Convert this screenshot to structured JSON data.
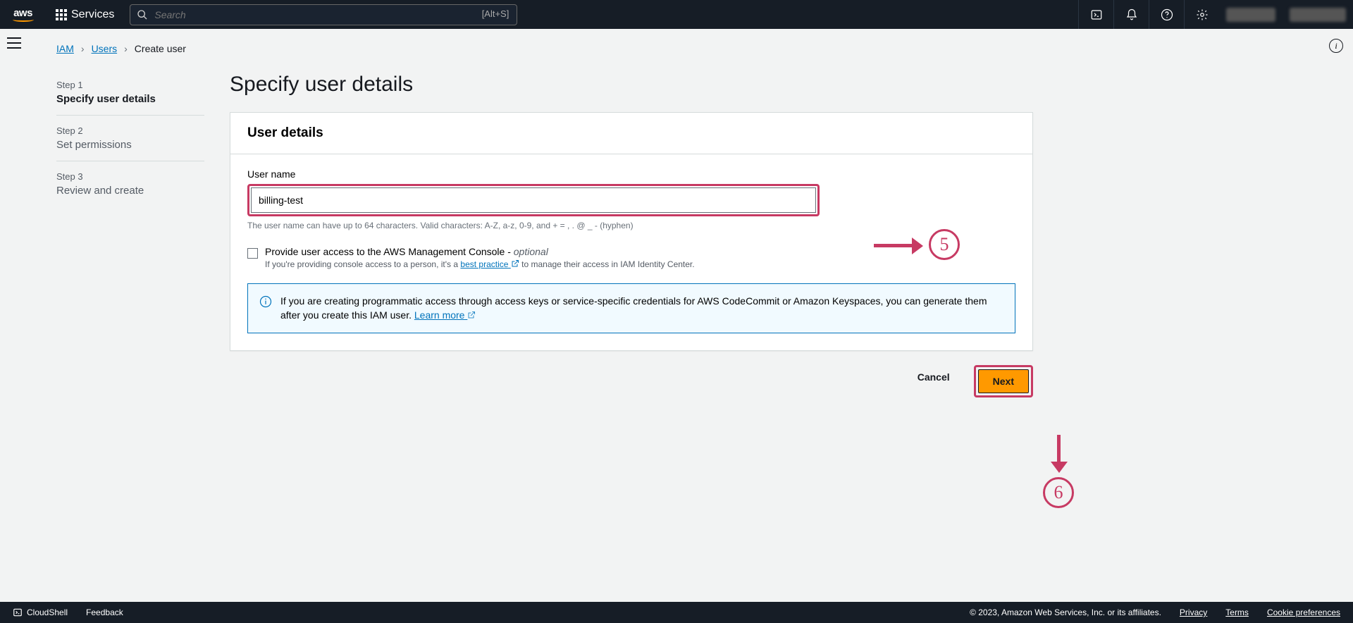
{
  "nav": {
    "services": "Services",
    "search_placeholder": "Search",
    "search_hint": "[Alt+S]"
  },
  "breadcrumbs": {
    "iam": "IAM",
    "users": "Users",
    "create": "Create user"
  },
  "wizard": {
    "step1_num": "Step 1",
    "step1_title": "Specify user details",
    "step2_num": "Step 2",
    "step2_title": "Set permissions",
    "step3_num": "Step 3",
    "step3_title": "Review and create"
  },
  "page": {
    "title": "Specify user details"
  },
  "panel": {
    "heading": "User details",
    "username_label": "User name",
    "username_value": "billing-test",
    "username_hint": "The user name can have up to 64 characters. Valid characters: A-Z, a-z, 0-9, and + = , . @ _ - (hyphen)",
    "console_check_main": "Provide user access to the AWS Management Console - ",
    "console_check_optional": "optional",
    "console_check_sub_a": "If you're providing console access to a person, it's a ",
    "console_check_sub_link": "best practice",
    "console_check_sub_b": " to manage their access in IAM Identity Center.",
    "info_text": "If you are creating programmatic access through access keys or service-specific credentials for AWS CodeCommit or Amazon Keyspaces, you can generate them after you create this IAM user. ",
    "info_link": "Learn more"
  },
  "actions": {
    "cancel": "Cancel",
    "next": "Next"
  },
  "callouts": {
    "c5": "5",
    "c6": "6"
  },
  "footer": {
    "cloudshell": "CloudShell",
    "feedback": "Feedback",
    "copyright": "© 2023, Amazon Web Services, Inc. or its affiliates.",
    "privacy": "Privacy",
    "terms": "Terms",
    "cookies": "Cookie preferences"
  }
}
